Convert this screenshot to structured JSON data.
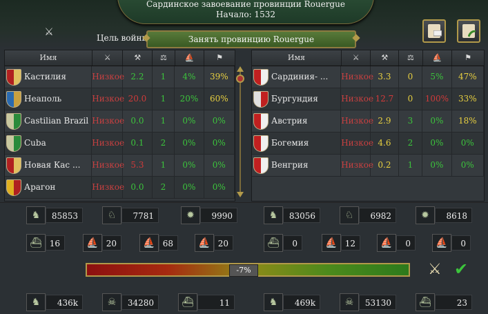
{
  "header": {
    "title": "Сардинское завоевание провинции Rouergue",
    "start": "Начало: 1532"
  },
  "war_goal": {
    "label": "Цель войны",
    "value": "Занять провинцию Rouergue"
  },
  "columns": {
    "name": "Имя"
  },
  "attackers": [
    {
      "name": "Кастилия",
      "rel": "Низкое",
      "a": "2.2",
      "b": "1",
      "c": "4%",
      "d": "39%",
      "colors": [
        "#b02020",
        "#e0c060"
      ]
    },
    {
      "name": "Неаполь",
      "rel": "Низкое",
      "a": "20.0",
      "b": "1",
      "c": "20%",
      "d": "60%",
      "colors": [
        "#2a6ab0",
        "#c8a040"
      ]
    },
    {
      "name": "Castilian Brazil",
      "rel": "Низкое",
      "a": "0.0",
      "b": "1",
      "c": "0%",
      "d": "0%",
      "colors": [
        "#c8c8a0",
        "#2a8a3a"
      ]
    },
    {
      "name": "Cuba",
      "rel": "Низкое",
      "a": "0.1",
      "b": "2",
      "c": "0%",
      "d": "0%",
      "colors": [
        "#c8c8a0",
        "#2a8a3a"
      ]
    },
    {
      "name": "Новая Кас ...",
      "rel": "Низкое",
      "a": "5.3",
      "b": "1",
      "c": "0%",
      "d": "0%",
      "colors": [
        "#b02020",
        "#e0c060"
      ]
    },
    {
      "name": "Арагон",
      "rel": "Низкое",
      "a": "0.0",
      "b": "2",
      "c": "0%",
      "d": "0%",
      "colors": [
        "#e0b020",
        "#b02020"
      ]
    }
  ],
  "defenders": [
    {
      "name": "Сардиния- ...",
      "rel": "Низкое",
      "a": "3.3",
      "b": "0",
      "c": "5%",
      "d": "47%",
      "colors": [
        "#c02020",
        "#f0f0f0"
      ]
    },
    {
      "name": "Бургундия",
      "rel": "Низкое",
      "a": "12.7",
      "b": "0",
      "c": "100%",
      "d": "33%",
      "colors": [
        "#e0e0e0",
        "#c02020"
      ]
    },
    {
      "name": "Австрия",
      "rel": "Низкое",
      "a": "2.9",
      "b": "3",
      "c": "0%",
      "d": "18%",
      "colors": [
        "#c02020",
        "#f0f0f0"
      ]
    },
    {
      "name": "Богемия",
      "rel": "Низкое",
      "a": "4.6",
      "b": "2",
      "c": "0%",
      "d": "0%",
      "colors": [
        "#c02020",
        "#f0f0f0"
      ]
    },
    {
      "name": "Венгрия",
      "rel": "Низкое",
      "a": "0.2",
      "b": "1",
      "c": "0%",
      "d": "0%",
      "colors": [
        "#c02020",
        "#f0f0f0"
      ]
    }
  ],
  "stats_left": {
    "infantry": "85853",
    "cavalry": "7781",
    "artillery": "9990",
    "heavy_ships": "16",
    "light_ships": "20",
    "galleys": "68",
    "transports": "20",
    "manpower": "436k",
    "losses": "34280",
    "ships_lost": "11"
  },
  "stats_right": {
    "infantry": "83056",
    "cavalry": "6982",
    "artillery": "8618",
    "heavy_ships": "0",
    "light_ships": "12",
    "galleys": "0",
    "transports": "0",
    "manpower": "469k",
    "losses": "53130",
    "ships_lost": "23"
  },
  "warscore": {
    "label": "-7%",
    "value": -7
  }
}
